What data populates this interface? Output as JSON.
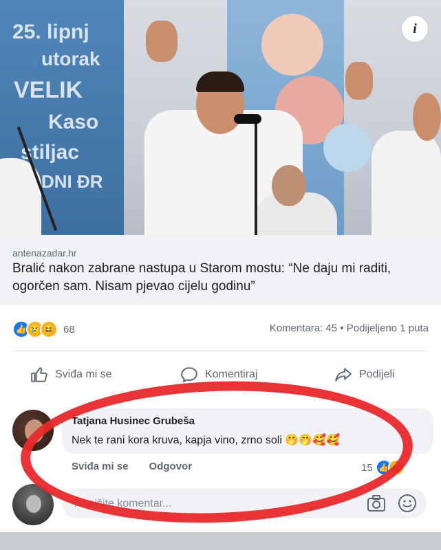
{
  "post": {
    "domain": "antenazadar.hr",
    "headline": "Bralić nakon zabrane nastupa u Starom mostu: “Ne daju mi raditi, ogorčen sam. Nisam pjevao cijelu godinu”",
    "banner_lines": [
      "25. lipnj",
      "utorak",
      "VELIK",
      "Kaso",
      "stiljac",
      "DNI ĐR"
    ]
  },
  "reactions": {
    "count": "68",
    "comments": "Komentara: 45",
    "separator": "•",
    "shares": "Podijeljeno 1 puta"
  },
  "actions": {
    "like": "Sviđa mi se",
    "comment": "Komentiraj",
    "share": "Podijeli"
  },
  "comment": {
    "author": "Tatjana Husinec Grubeša",
    "text": "Nek te rani kora kruva, kapja vino, zrno soli 🤭🤭🥰🥰",
    "like": "Sviđa mi se",
    "reply": "Odgovor",
    "reaction_count": "15"
  },
  "composer": {
    "placeholder": "Napišite komentar..."
  },
  "colors": {
    "accent": "#1877f2",
    "highlight": "#e8282b"
  }
}
